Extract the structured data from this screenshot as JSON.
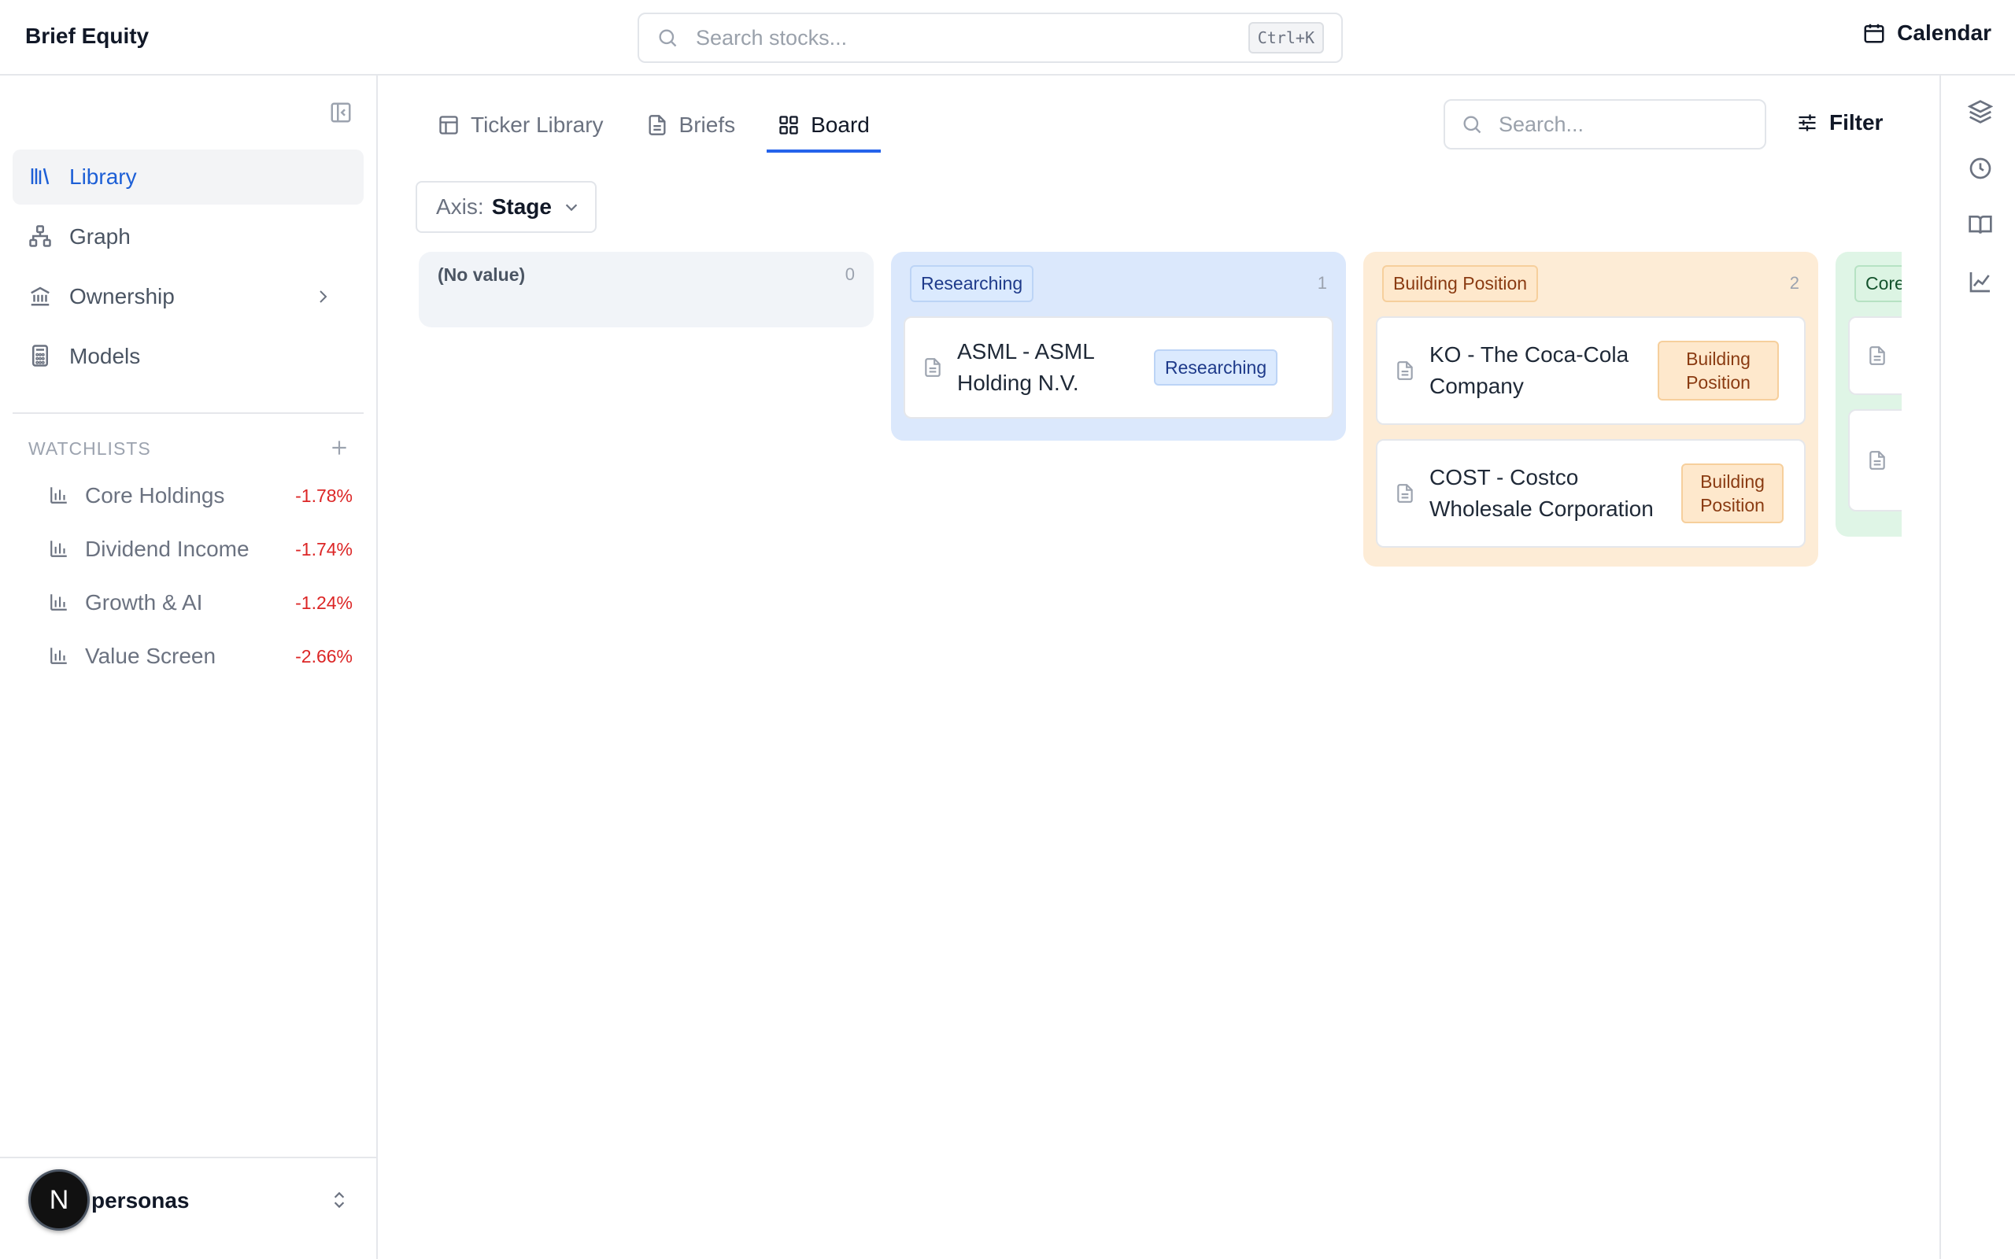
{
  "header": {
    "brand": "Brief Equity",
    "search_placeholder": "Search stocks...",
    "shortcut": "Ctrl+K",
    "calendar_label": "Calendar"
  },
  "sidebar": {
    "items": [
      {
        "label": "Library",
        "icon": "library-icon",
        "active": true
      },
      {
        "label": "Graph",
        "icon": "graph-icon"
      },
      {
        "label": "Ownership",
        "icon": "bank-icon",
        "has_submenu": true
      },
      {
        "label": "Models",
        "icon": "calculator-icon"
      }
    ],
    "watchlists_title": "WATCHLISTS",
    "watchlists": [
      {
        "name": "Core Holdings",
        "change": "-1.78%"
      },
      {
        "name": "Dividend Income",
        "change": "-1.74%"
      },
      {
        "name": "Growth & AI",
        "change": "-1.24%"
      },
      {
        "name": "Value Screen",
        "change": "-2.66%"
      }
    ],
    "user": {
      "initial": "N",
      "name": "personas"
    }
  },
  "main": {
    "tabs": [
      {
        "label": "Ticker Library",
        "icon": "table-icon"
      },
      {
        "label": "Briefs",
        "icon": "document-icon"
      },
      {
        "label": "Board",
        "icon": "grid-icon",
        "active": true
      }
    ],
    "search_placeholder": "Search...",
    "filter_label": "Filter",
    "axis": {
      "label": "Axis:",
      "value": "Stage"
    },
    "board": {
      "columns": [
        {
          "title": "(No value)",
          "count": "0",
          "cards": []
        },
        {
          "title": "Researching",
          "count": "1",
          "color": "#dbe8fc",
          "cards": [
            {
              "title": "ASML - ASML Holding N.V.",
              "badge": "Researching"
            }
          ]
        },
        {
          "title": "Building Position",
          "count": "2",
          "color": "#fdecd6",
          "cards": [
            {
              "title": "KO - The Coca-Cola Company",
              "badge": "Building Position"
            },
            {
              "title": "COST - Costco Wholesale Corporation",
              "badge": "Building Position"
            }
          ]
        },
        {
          "title": "Core",
          "color": "#dff5e6",
          "cards": []
        }
      ]
    }
  },
  "colors": {
    "accent": "#2563eb",
    "negative": "#dc2626"
  }
}
